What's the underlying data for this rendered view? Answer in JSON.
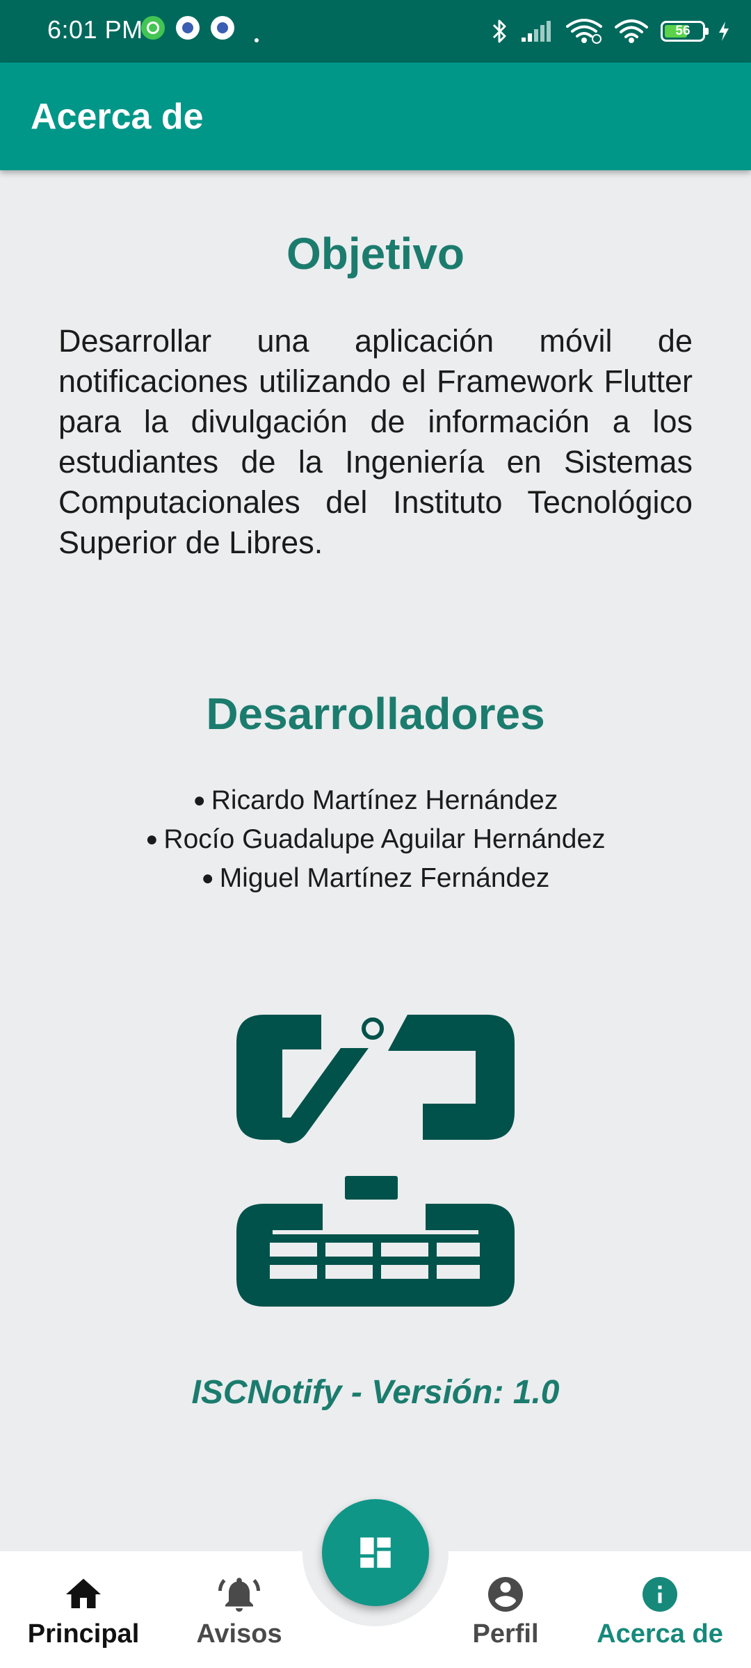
{
  "status_bar": {
    "time": "6:01 PM",
    "battery_level": "56",
    "icons": [
      "whatsapp-icon",
      "app-notification-icon",
      "app-notification-icon",
      "bluetooth-icon",
      "signal-icon",
      "wifi-icon",
      "wifi-icon",
      "battery-icon",
      "charging-icon"
    ]
  },
  "app_bar": {
    "title": "Acerca de"
  },
  "objective": {
    "heading": "Objetivo",
    "text": "Desarrollar una aplicación móvil de notificaciones utilizando el Framework Flutter para la divulgación de información a los estudiantes de la Ingeniería en Sistemas Computacionales del Instituto Tecnológico Superior de Libres."
  },
  "developers": {
    "heading": "Desarrolladores",
    "bullet": "●",
    "names": [
      "Ricardo Martínez Hernández",
      "Rocío Guadalupe Aguilar Hernández",
      "Miguel Martínez Fernández"
    ]
  },
  "logo": {
    "icon": "isc-logo-icon",
    "color": "#00524a"
  },
  "version": "ISCNotify - Versión: 1.0",
  "bottom_nav": {
    "items": [
      {
        "label": "Principal",
        "icon": "home-icon"
      },
      {
        "label": "Avisos",
        "icon": "bell-icon"
      },
      {
        "label": "Perfil",
        "icon": "account-circle-icon"
      },
      {
        "label": "Acerca de",
        "icon": "info-icon"
      }
    ],
    "fab_icon": "dashboard-icon",
    "active_item": "Acerca de"
  },
  "colors": {
    "status_bar": "#00695c",
    "app_bar": "#009688",
    "accent_text": "#1b7c6e",
    "background": "#ecedef",
    "fab": "#0f9687",
    "active_nav": "#16897b"
  }
}
